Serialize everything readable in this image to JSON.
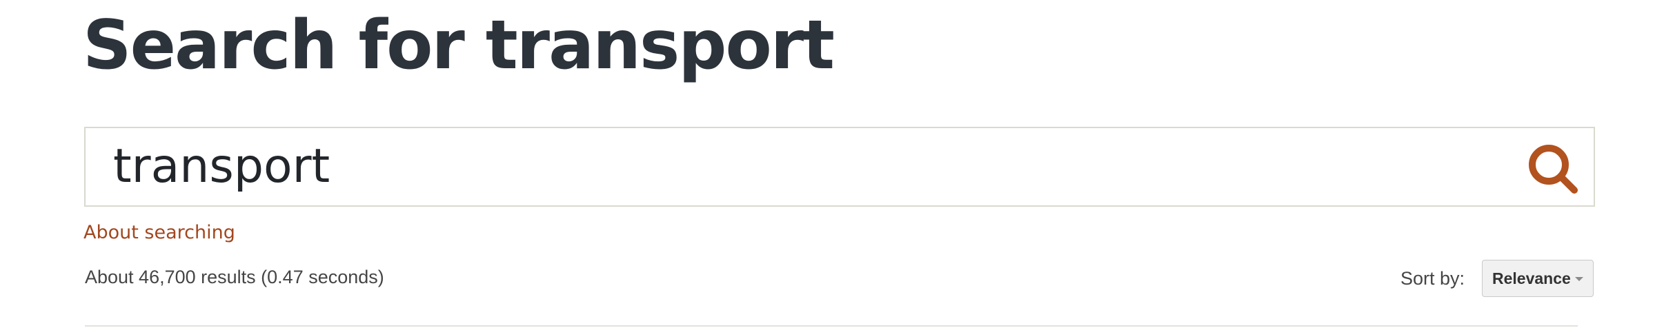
{
  "header": {
    "title": "Search for transport"
  },
  "search": {
    "query": "transport",
    "icon": "search-icon",
    "icon_color": "#b2521e"
  },
  "links": {
    "about_searching": "About searching"
  },
  "results": {
    "summary": "About 46,700 results (0.47 seconds)"
  },
  "sort": {
    "label": "Sort by:",
    "selected": "Relevance",
    "icon": "chevron-down-icon"
  },
  "colors": {
    "title": "#2c333b",
    "link": "#a3471f",
    "search_border": "#d9d9cf"
  }
}
